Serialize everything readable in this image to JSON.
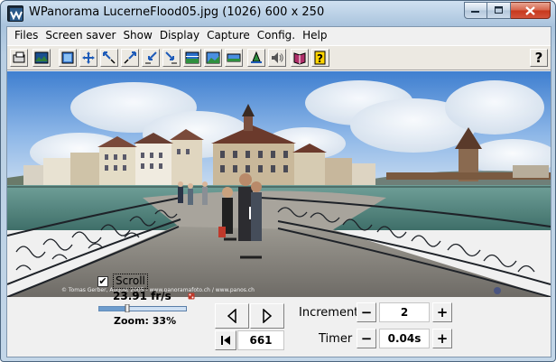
{
  "window": {
    "title": "WPanorama  LucerneFlood05.jpg  (1026) 600 x 250"
  },
  "menu": {
    "items": [
      "Files",
      "Screen saver",
      "Show",
      "Display",
      "Capture",
      "Config.",
      "Help"
    ]
  },
  "toolbar": {
    "buttons": [
      "open-file-icon",
      "show-picture-icon",
      "fullscreen-icon",
      "move-icon",
      "zoom-out-icon",
      "zoom-in-icon",
      "shrink-icon",
      "expand-icon",
      "fit-image-icon",
      "landscape-icon",
      "stretch-icon",
      "panorama-icon",
      "sound-icon",
      "book-icon",
      "help-book-icon"
    ],
    "help_label": "?"
  },
  "viewport": {
    "credit": "© Tomas Gerber, August 2005 - www.panoramafoto.ch / www.panos.ch"
  },
  "controls": {
    "scroll_checked": true,
    "scroll_label": "Scroll",
    "fps": "23.91 fr/s",
    "zoom": "Zoom: 33%",
    "zoom_fraction": 0.33,
    "position_value": "661",
    "increment_label": "Increment",
    "increment_value": "2",
    "timer_label": "Timer",
    "timer_value": "0.04s",
    "minus": "−",
    "plus": "+"
  },
  "colors": {
    "titlebar": "#b9cfe3",
    "close_button": "#c7371c",
    "sky": "#6fa0d8",
    "water": "#5d8f87"
  }
}
